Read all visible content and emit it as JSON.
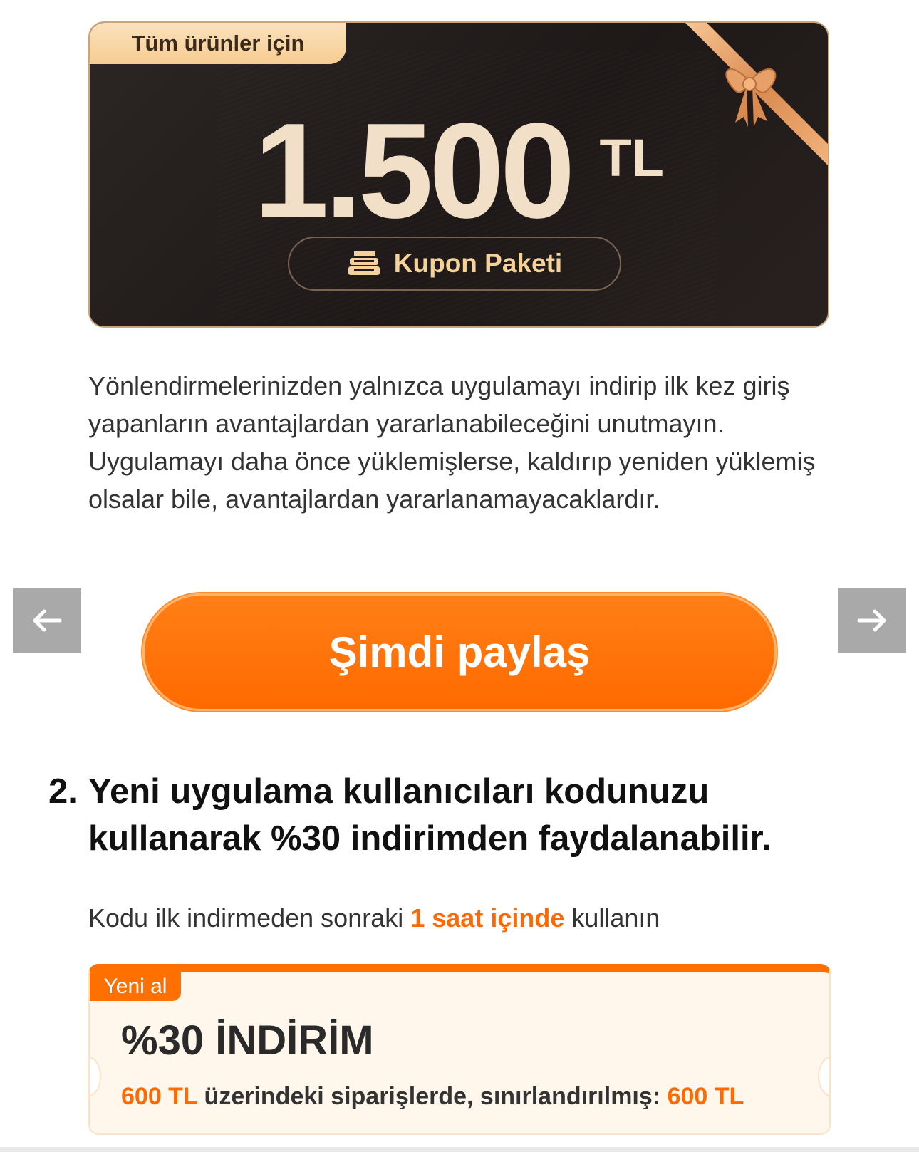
{
  "pack": {
    "tag": "Tüm ürünler için",
    "amount": "1.500",
    "currency": "TL",
    "pill_label": "Kupon Paketi"
  },
  "info_text": "Yönlendirmelerinizden yalnızca uygulamayı indirip ilk kez giriş yapanların avantajlardan yararlanabileceğini unutmayın. Uygulamayı daha önce yüklemişlerse, kaldırıp yeniden yüklemiş olsalar bile, avantajlardan yararlanamayacaklardır.",
  "share_button": "Şimdi paylaş",
  "nav": {
    "prev_icon": "arrow-left-icon",
    "next_icon": "arrow-right-icon"
  },
  "step2": {
    "number": "2.",
    "title": "Yeni uygulama kullanıcıları kodunuzu kullanarak %30 indirimden faydalanabilir.",
    "hint_before": "Kodu ilk indirmeden sonraki ",
    "hint_highlight": "1 saat içinde",
    "hint_after": " kullanın"
  },
  "coupon": {
    "tag": "Yeni al",
    "title": "%30 İNDİRİM",
    "cond_amount": "600 TL",
    "cond_text": " üzerindeki siparişlerde, sınırlandırılmış: ",
    "cond_limit": "600 TL"
  },
  "colors": {
    "accent": "#ff6a00",
    "card_dark": "#221c1b",
    "gold": "#f1dfc7",
    "tag_gold": "#f6cc92"
  }
}
